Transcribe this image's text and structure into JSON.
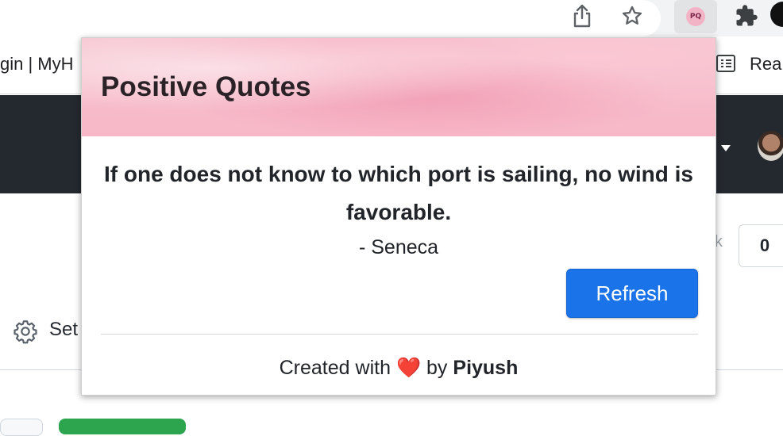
{
  "browser": {
    "bookmark_left": "gin | MyH",
    "bookmark_right": "Rea",
    "extension_icon_text": "PQ"
  },
  "page_behind": {
    "counter_value": "0",
    "counter_label_fragment": "k",
    "settings_label": "Set"
  },
  "popup": {
    "title": "Positive Quotes",
    "quote": "If one does not know to which port is sailing, no wind is favorable.",
    "author": "- Seneca",
    "refresh_label": "Refresh",
    "footer": {
      "prefix": "Created with",
      "heart": "❤️",
      "by": "by",
      "author_name": "Piyush"
    }
  },
  "colors": {
    "accent": "#1a73e8",
    "header_pink": "#f6c3cf",
    "page_header_dark": "#24292f"
  }
}
